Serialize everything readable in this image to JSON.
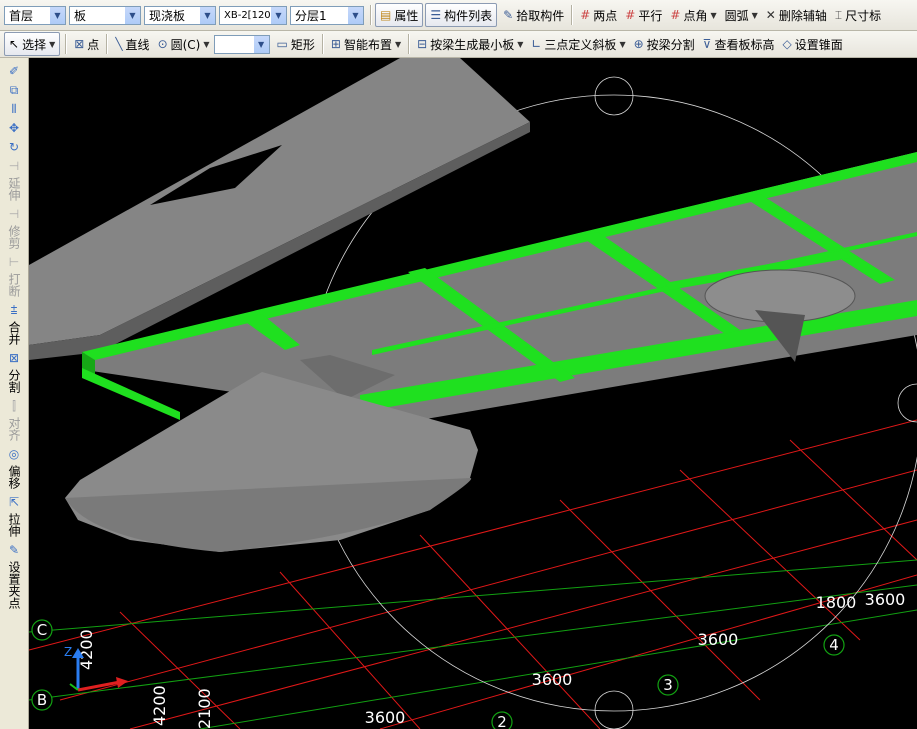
{
  "toolbar1": {
    "floor": "首层",
    "element_type": "板",
    "subtype": "现浇板",
    "component": "XB-2[120]",
    "layer": "分层1",
    "properties": "属性",
    "component_list": "构件列表",
    "pick_component": "拾取构件",
    "two_point": "两点",
    "parallel": "平行",
    "point_angle": "点角",
    "arc": "圆弧",
    "delete_aux": "删除辅轴",
    "dimension": "尺寸标"
  },
  "toolbar2": {
    "select": "选择",
    "point": "点",
    "line": "直线",
    "circle": "圆(C)",
    "rect": "矩形",
    "smart_layout": "智能布置",
    "beam_min_slab": "按梁生成最小板",
    "three_point_slope": "三点定义斜板",
    "split_by_beam": "按梁分割",
    "view_slab_height": "查看板标高",
    "set_cone": "设置锥面"
  },
  "sidebar": {
    "extend": "延伸",
    "trim": "修剪",
    "break": "打断",
    "merge": "合并",
    "split": "分割",
    "align": "对齐",
    "offset": "偏移",
    "stretch": "拉伸",
    "set_clamp": "设置夹点"
  },
  "viewport": {
    "axis_letters": [
      "C",
      "B"
    ],
    "axis_numbers": [
      "2",
      "3",
      "4"
    ],
    "dimensions": {
      "d1": "3600",
      "d2": "3600",
      "d3": "3600",
      "d4": "1800",
      "d5": "3600",
      "v1": "4200",
      "v2": "4200",
      "v3": "2100"
    },
    "axis_z": "Z",
    "colors": {
      "beam": "#1fe01f",
      "slab": "#808080",
      "grid_red": "#e01818",
      "grid_green": "#12a012"
    }
  }
}
